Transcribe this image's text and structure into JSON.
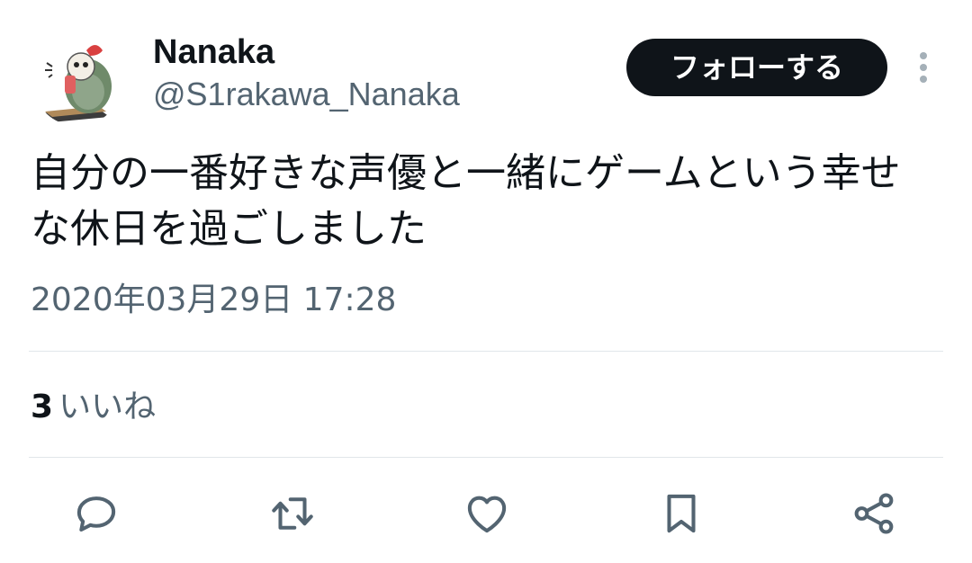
{
  "user": {
    "display_name": "Nanaka",
    "handle": "@S1rakawa_Nanaka",
    "avatar_icon": "avatar-illustration-icon"
  },
  "follow_button": {
    "label": "フォローする"
  },
  "more_button": {
    "icon": "more-vertical-icon"
  },
  "tweet": {
    "text": "自分の一番好きな声優と一緒にゲームという幸せな休日を過ごしました",
    "timestamp": "2020年03月29日 17:28"
  },
  "stats": {
    "likes_count": "3",
    "likes_label": "いいね"
  },
  "actions": [
    {
      "name": "reply",
      "icon": "reply-icon"
    },
    {
      "name": "retweet",
      "icon": "retweet-icon"
    },
    {
      "name": "like",
      "icon": "heart-icon"
    },
    {
      "name": "bookmark",
      "icon": "bookmark-icon"
    },
    {
      "name": "share",
      "icon": "share-icon"
    }
  ],
  "colors": {
    "text_primary": "#0f1419",
    "text_secondary": "#536471",
    "divider": "#e1e6ea",
    "button_bg": "#0f1419",
    "button_text": "#ffffff",
    "icon": "#536471"
  }
}
